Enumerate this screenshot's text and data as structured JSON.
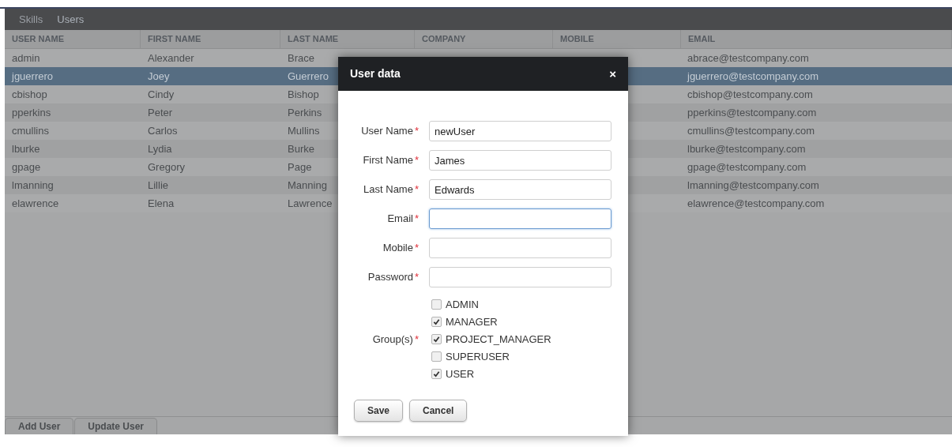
{
  "nav": [
    {
      "label": "Skills",
      "selected": false
    },
    {
      "label": "Users",
      "selected": true
    }
  ],
  "table": {
    "columns": [
      "USER NAME",
      "FIRST NAME",
      "LAST NAME",
      "COMPANY",
      "MOBILE",
      "EMAIL"
    ],
    "rows": [
      {
        "user": "admin",
        "first": "Alexander",
        "last": "Brace",
        "email": "abrace@testcompany.com",
        "selected": false
      },
      {
        "user": "jguerrero",
        "first": "Joey",
        "last": "Guerrero",
        "email": "jguerrero@testcompany.com",
        "selected": true
      },
      {
        "user": "cbishop",
        "first": "Cindy",
        "last": "Bishop",
        "email": "cbishop@testcompany.com",
        "selected": false
      },
      {
        "user": "pperkins",
        "first": "Peter",
        "last": "Perkins",
        "email": "pperkins@testcompany.com",
        "selected": false
      },
      {
        "user": "cmullins",
        "first": "Carlos",
        "last": "Mullins",
        "email": "cmullins@testcompany.com",
        "selected": false
      },
      {
        "user": "lburke",
        "first": "Lydia",
        "last": "Burke",
        "email": "lburke@testcompany.com",
        "selected": false
      },
      {
        "user": "gpage",
        "first": "Gregory",
        "last": "Page",
        "email": "gpage@testcompany.com",
        "selected": false
      },
      {
        "user": "lmanning",
        "first": "Lillie",
        "last": "Manning",
        "email": "lmanning@testcompany.com",
        "selected": false
      },
      {
        "user": "elawrence",
        "first": "Elena",
        "last": "Lawrence",
        "email": "elawrence@testcompany.com",
        "selected": false
      }
    ]
  },
  "bottom_tabs": [
    "Add User",
    "Update User"
  ],
  "dialog": {
    "title": "User data",
    "close": "×",
    "fields": [
      {
        "label": "User Name",
        "required": "*",
        "value": "newUser",
        "focused": false
      },
      {
        "label": "First Name",
        "required": "*",
        "value": "James",
        "focused": false
      },
      {
        "label": "Last Name",
        "required": "*",
        "value": "Edwards",
        "focused": false
      },
      {
        "label": "Email",
        "required": "*",
        "focused": true
      },
      {
        "label": "Mobile",
        "required": "*",
        "focused": false
      },
      {
        "label": "Password",
        "required": "*",
        "focused": false
      }
    ],
    "groups": {
      "label": "Group(s)",
      "required": "*",
      "options": [
        {
          "label": "ADMIN",
          "checked": false
        },
        {
          "label": "MANAGER",
          "checked": true
        },
        {
          "label": "PROJECT_MANAGER",
          "checked": true
        },
        {
          "label": "SUPERUSER",
          "checked": false
        },
        {
          "label": "USER",
          "checked": true
        }
      ]
    },
    "buttons": [
      "Save",
      "Cancel"
    ]
  }
}
